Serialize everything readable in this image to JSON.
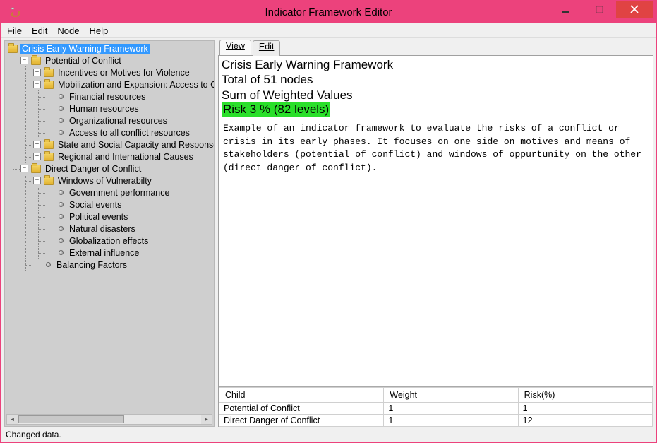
{
  "window": {
    "title": "Indicator Framework Editor"
  },
  "menubar": {
    "items": [
      {
        "label": "File",
        "u": "F"
      },
      {
        "label": "Edit",
        "u": "E"
      },
      {
        "label": "Node",
        "u": "N"
      },
      {
        "label": "Help",
        "u": "H"
      }
    ]
  },
  "tree": {
    "root_label": "Crisis Early Warning Framework",
    "branches": {
      "potential": {
        "label": "Potential of Conflict",
        "children_closed": [
          "Incentives or Motives for Violence"
        ],
        "mobilization": {
          "label": "Mobilization and Expansion: Access to Conflict resources",
          "leaves": [
            "Financial resources",
            "Human resources",
            "Organizational resources",
            "Access to all conflict resources"
          ]
        },
        "closed2": [
          "State and Social Capacity and Response",
          "Regional and International Causes"
        ]
      },
      "direct": {
        "label": "Direct Danger of Conflict",
        "windows": {
          "label": "Windows of Vulnerabilty",
          "leaves": [
            "Government performance",
            "Social events",
            "Political  events",
            "Natural disasters",
            "Globalization effects",
            "External influence"
          ]
        },
        "balancing": "Balancing Factors"
      }
    }
  },
  "tabs": {
    "view": "View",
    "edit": "Edit"
  },
  "summary": {
    "title": "Crisis Early Warning Framework",
    "total": "Total of 51 nodes",
    "sum": "Sum of Weighted Values",
    "risk": "Risk 3 % (82 levels)"
  },
  "description": "Example of an indicator framework to evaluate the risks of a conflict or crisis in its early phases. It focuses on one side on motives and means of stakeholders (potential of conflict) and windows of oppurtunity on the other (direct danger of conflict).",
  "child_table": {
    "headers": {
      "child": "Child",
      "weight": "Weight",
      "risk": "Risk(%)"
    },
    "rows": [
      {
        "child": "Potential of Conflict",
        "weight": "1",
        "risk": "1"
      },
      {
        "child": "Direct Danger of Conflict",
        "weight": "1",
        "risk": "12"
      }
    ]
  },
  "statusbar": {
    "text": "Changed data."
  },
  "toggles": {
    "plus": "+",
    "minus": "−"
  },
  "scroll_arrows": {
    "left": "◄",
    "right": "►"
  }
}
